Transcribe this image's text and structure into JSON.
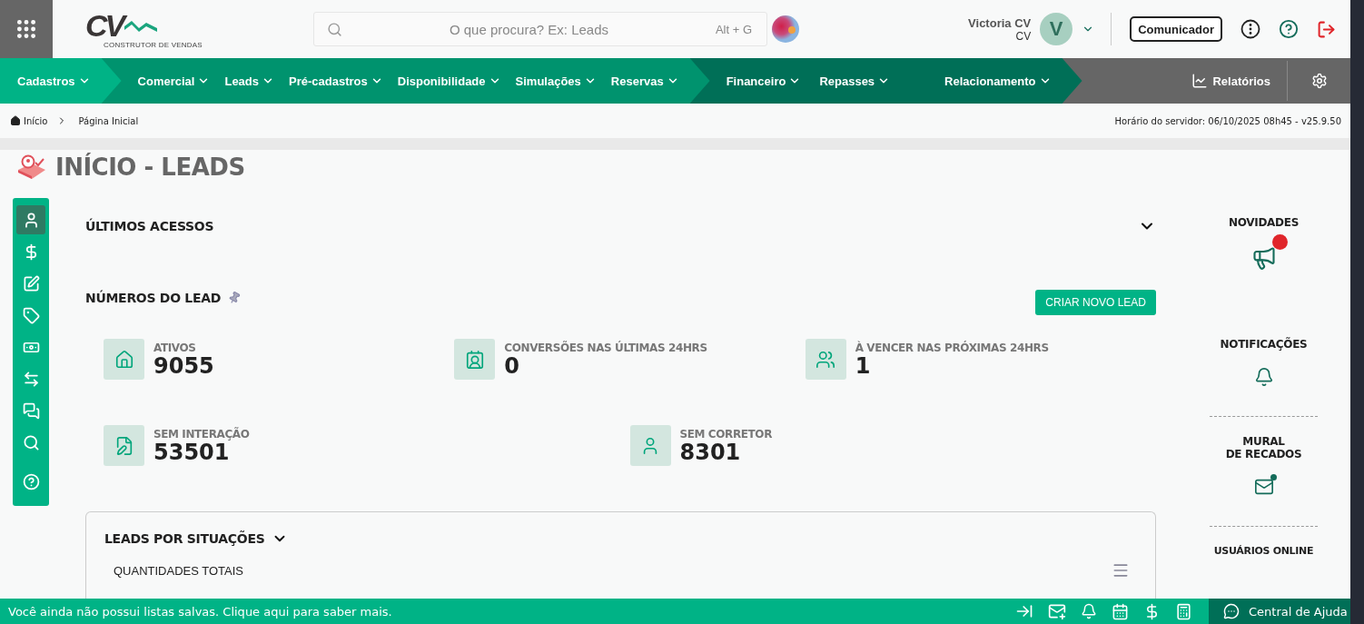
{
  "logo": {
    "mark": "CV",
    "subtitle": "CONSTRUTOR DE VENDAS"
  },
  "search": {
    "placeholder": "O que procura? Ex: Leads",
    "shortcut": "Alt + G"
  },
  "user": {
    "name": "Victoria CV",
    "company": "CV",
    "initial": "V"
  },
  "communicator_button": "Comunicador",
  "nav_groups": [
    {
      "color": "#00b386",
      "items": [
        {
          "label": "Cadastros"
        }
      ]
    },
    {
      "color": "#00936e",
      "items": [
        {
          "label": "Comercial"
        },
        {
          "label": "Leads"
        },
        {
          "label": "Pré-cadastros"
        },
        {
          "label": "Disponibilidade"
        },
        {
          "label": "Simulações"
        },
        {
          "label": "Reservas"
        }
      ]
    },
    {
      "color": "#006f57",
      "items": [
        {
          "label": "Financeiro"
        },
        {
          "label": "Repasses"
        },
        {
          "label": "Relacionamento"
        }
      ]
    }
  ],
  "reports": "Relatórios",
  "breadcrumb": [
    "Início",
    "Página Inicial"
  ],
  "server_time": "Horário do servidor: 06/10/2025 08h45 - v25.9.50",
  "page_title": "INÍCIO - LEADS",
  "side_rail": [
    {
      "kind": "user",
      "selected": true
    },
    {
      "kind": "dollar",
      "selected": false
    },
    {
      "kind": "edit",
      "selected": false
    },
    {
      "kind": "tag",
      "selected": false
    },
    {
      "kind": "cash",
      "selected": false
    },
    {
      "kind": "transfer",
      "selected": false
    },
    {
      "kind": "chat",
      "selected": false
    },
    {
      "kind": "search",
      "selected": false
    },
    {
      "kind": "help",
      "selected": false
    }
  ],
  "recent_access": {
    "title": "ÚLTIMOS ACESSOS"
  },
  "lead_numbers": {
    "title": "NÚMEROS DO LEAD",
    "create_button": "CRIAR NOVO LEAD",
    "stat_rows": [
      [
        {
          "kind": "home",
          "label": "ATIVOS",
          "value": "9055"
        },
        {
          "kind": "contact",
          "label": "CONVERSÕES NAS ÚLTIMAS 24HRS",
          "value": "0"
        },
        {
          "kind": "users",
          "label": "À VENCER NAS PRÓXIMAS 24HRS",
          "value": "1"
        }
      ],
      [
        {
          "kind": "file",
          "label": "SEM INTERAÇÃO",
          "value": "53501"
        },
        {
          "kind": "user",
          "label": "SEM CORRETOR",
          "value": "8301"
        }
      ]
    ]
  },
  "situations": {
    "title": "LEADS POR SITUAÇÕES",
    "subtitle": "QUANTIDADES TOTAIS"
  },
  "right_panel": [
    {
      "kind": "news",
      "title": "NOVIDADES",
      "unread": true
    },
    {
      "kind": "notifications",
      "title": "NOTIFICAÇÕES",
      "unread": false
    },
    {
      "kind": "mural",
      "title": "MURAL\nDE RECADOS",
      "unread": true
    },
    {
      "kind": "online",
      "title": "USUÁRIOS ONLINE"
    }
  ],
  "footer": {
    "message": "Você ainda não possui listas salvas. Clique aqui para saber mais.",
    "help": "Central de Ajuda"
  }
}
